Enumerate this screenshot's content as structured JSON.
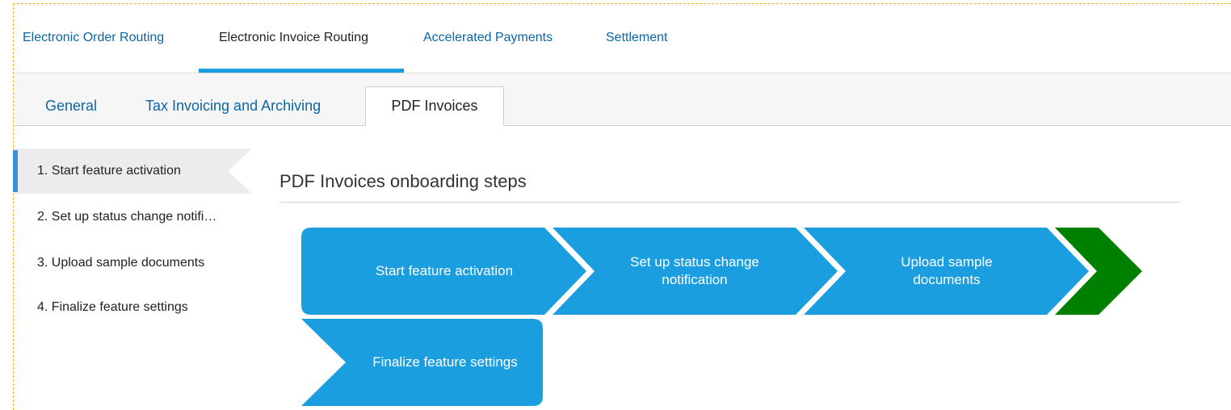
{
  "top_tabs": [
    {
      "label": "Electronic Order Routing",
      "active": false
    },
    {
      "label": "Electronic Invoice Routing",
      "active": true
    },
    {
      "label": "Accelerated Payments",
      "active": false
    },
    {
      "label": "Settlement",
      "active": false
    }
  ],
  "sub_tabs": [
    {
      "label": "General",
      "active": false
    },
    {
      "label": "Tax Invoicing and Archiving",
      "active": false
    },
    {
      "label": "PDF Invoices",
      "active": true
    }
  ],
  "step_nav": [
    {
      "label": "1. Start feature activation",
      "active": true
    },
    {
      "label": "2. Set up status change notifi…",
      "active": false
    },
    {
      "label": "3. Upload sample documents",
      "active": false
    },
    {
      "label": "4. Finalize feature settings",
      "active": false
    }
  ],
  "content": {
    "title": "PDF Invoices onboarding steps"
  },
  "flow_steps": [
    {
      "label": "Start feature activation",
      "color": "#1b9ee0"
    },
    {
      "label": "Set up status change notification",
      "color": "#1b9ee0"
    },
    {
      "label": "Upload sample documents",
      "color": "#1b9ee0"
    },
    {
      "label": "",
      "color": "#008000"
    },
    {
      "label": "Finalize feature settings",
      "color": "#1b9ee0"
    }
  ],
  "colors": {
    "accent_blue": "#1b9ee0",
    "link_blue": "#0b65a8",
    "complete_green": "#008000",
    "frame_dash": "#e8b420"
  }
}
